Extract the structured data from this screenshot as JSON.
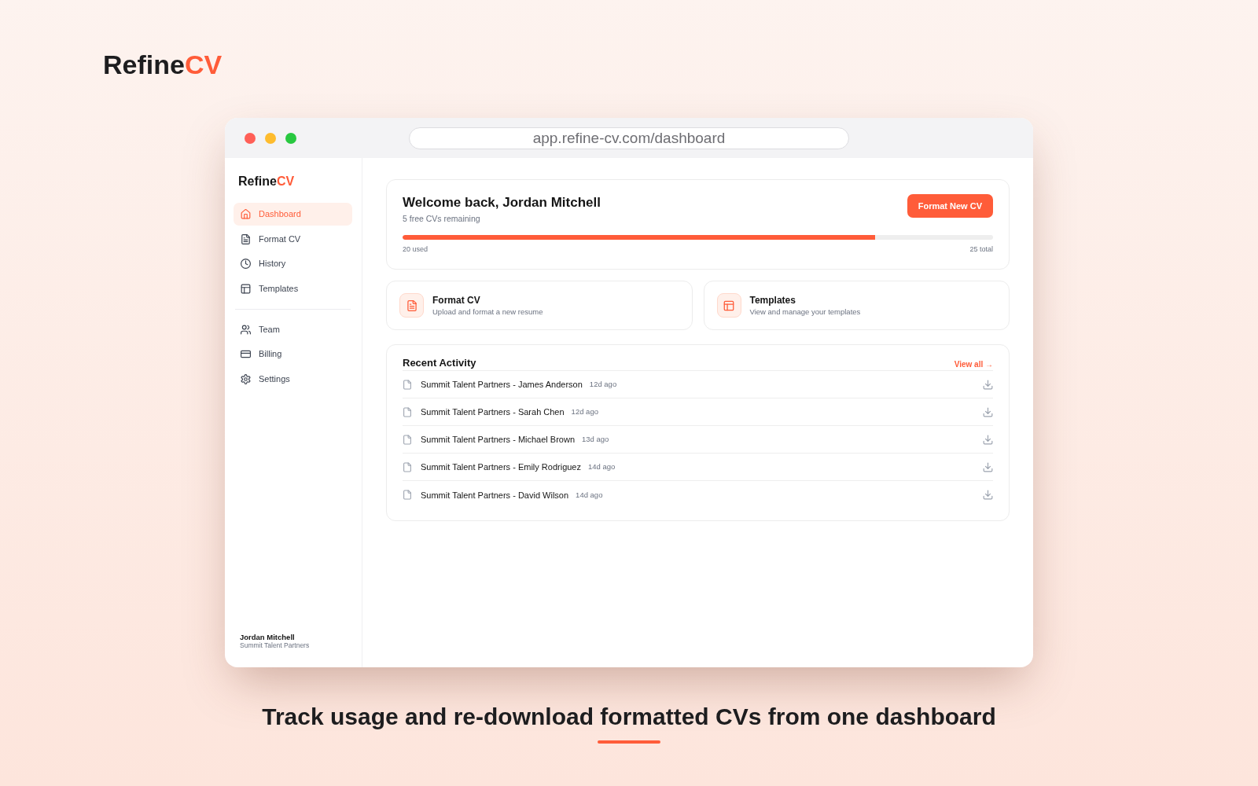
{
  "brand": {
    "name": "Refine",
    "accent": "CV"
  },
  "browser": {
    "url": "app.refine-cv.com/dashboard"
  },
  "sidebar": {
    "brand": {
      "name": "Refine",
      "accent": "CV"
    },
    "nav_groups": [
      {
        "items": [
          {
            "label": "Dashboard",
            "selected": true
          },
          {
            "label": "Format CV",
            "selected": false
          },
          {
            "label": "History",
            "selected": false
          },
          {
            "label": "Templates",
            "selected": false
          }
        ]
      },
      {
        "items": [
          {
            "label": "Team",
            "selected": false
          },
          {
            "label": "Billing",
            "selected": false
          },
          {
            "label": "Settings",
            "selected": false
          }
        ]
      }
    ],
    "user": {
      "name": "Jordan Mitchell",
      "company": "Summit Talent Partners"
    }
  },
  "welcome": {
    "title": "Welcome back, Jordan Mitchell",
    "subtitle": "5 free CVs remaining",
    "button": "Format New CV",
    "usage": {
      "level": 0.8,
      "used": "20 used",
      "total": "25 total"
    }
  },
  "quick_actions": [
    {
      "title": "Format CV",
      "description": "Upload and format a new resume"
    },
    {
      "title": "Templates",
      "description": "View and manage your templates"
    }
  ],
  "recent_activity": {
    "title": "Recent Activity",
    "link": "View all →",
    "items": [
      {
        "name": "Summit Talent Partners - James Anderson",
        "time": "12d ago"
      },
      {
        "name": "Summit Talent Partners - Sarah Chen",
        "time": "12d ago"
      },
      {
        "name": "Summit Talent Partners - Michael Brown",
        "time": "13d ago"
      },
      {
        "name": "Summit Talent Partners - Emily Rodriguez",
        "time": "14d ago"
      },
      {
        "name": "Summit Talent Partners - David Wilson",
        "time": "14d ago"
      }
    ]
  },
  "caption": "Track usage and re-download formatted CVs from one dashboard"
}
